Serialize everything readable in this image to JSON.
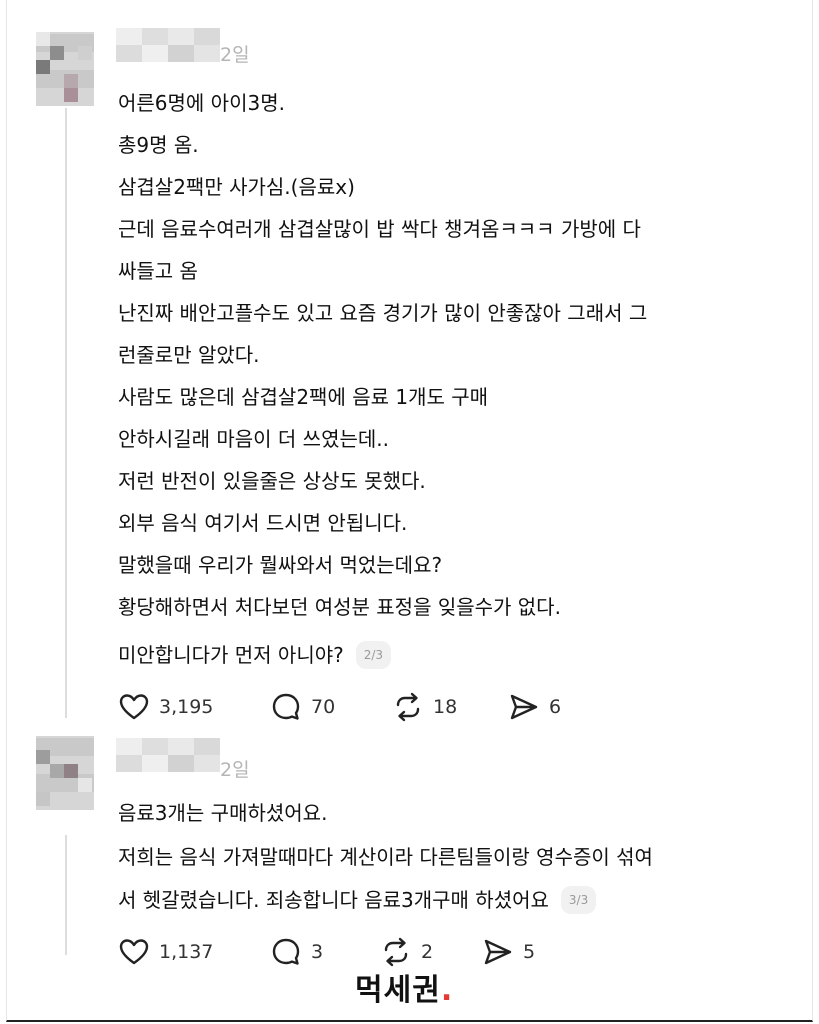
{
  "comments": [
    {
      "time": "2일",
      "lines": [
        "어른6명에 아이3명.",
        "총9명 옴.",
        "삼겹살2팩만 사가심.(음료x)",
        "근데 음료수여러개 삼겹살많이 밥 싹다 챙겨옴ㅋㅋㅋ 가방에 다",
        "싸들고 옴",
        "난진짜 배안고플수도 있고 요즘 경기가 많이 안좋잖아 그래서 그",
        "런줄로만 알았다.",
        "사람도 많은데 삼겹살2팩에 음료 1개도 구매",
        "안하시길래 마음이 더 쓰였는데..",
        "저런 반전이 있을줄은 상상도 못했다.",
        "외부 음식 여기서 드시면 안됩니다.",
        "말했을때 우리가 뭘싸와서 먹었는데요?",
        "황당해하면서 처다보던 여성분 표정을 잊을수가 없다.",
        "미안합니다가 먼저 아니야?"
      ],
      "pager": "2/3",
      "likes": "3,195",
      "replies": "70",
      "reposts": "18",
      "shares": "6"
    },
    {
      "time": "2일",
      "lines": [
        "음료3개는 구매하셨어요.",
        "저희는 음식 가져말때마다 계산이라 다른팀들이랑 영수증이 섞여",
        "서 헷갈렸습니다. 죄송합니다 음료3개구매 하셨어요"
      ],
      "pager": "3/3",
      "likes": "1,137",
      "replies": "3",
      "reposts": "2",
      "shares": "5"
    }
  ],
  "watermark": {
    "text": "먹세권",
    "dot": ".",
    "dot_color": "#e53935"
  },
  "icons": [
    "heart-icon",
    "comment-icon",
    "repost-icon",
    "share-icon"
  ]
}
